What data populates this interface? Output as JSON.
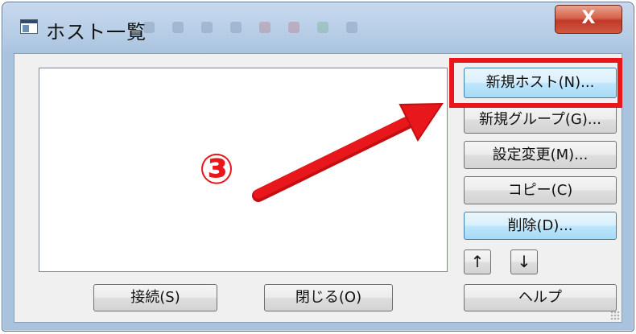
{
  "window": {
    "title": "ホスト一覧",
    "close_label": "X"
  },
  "buttons": {
    "new_host": "新規ホスト(N)...",
    "new_group": "新規グループ(G)...",
    "edit": "設定変更(M)...",
    "copy": "コピー(C)",
    "delete": "削除(D)...",
    "up": "↑",
    "down": "↓",
    "help": "ヘルプ",
    "connect": "接続(S)",
    "close": "閉じる(O)"
  },
  "annotation": {
    "step_label": "③",
    "color": "#e8171b"
  },
  "host_list": {
    "items": []
  }
}
